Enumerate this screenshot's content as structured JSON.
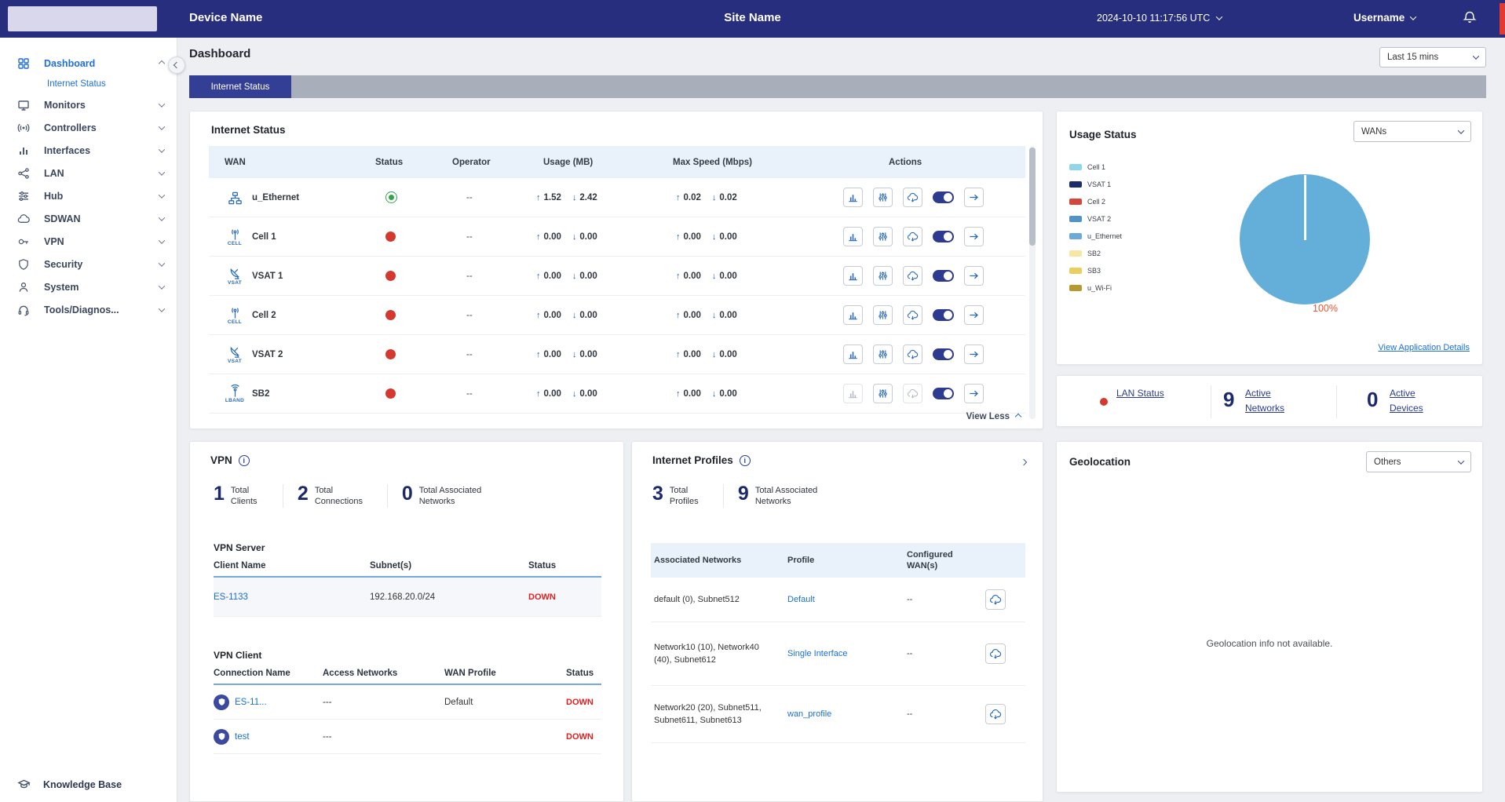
{
  "colors": {
    "topbar_bg": "#272e7d",
    "accent_blue": "#1b6fd8",
    "navy": "#1c296b",
    "status_up_green": "#35a34b",
    "status_down_red": "#d5382e",
    "down_text_red": "#e01f1f",
    "pie_label_orange": "#e4572e"
  },
  "topbar": {
    "device_name": "Device Name",
    "site_name": "Site Name",
    "datetime": "2024-10-10 11:17:56 UTC",
    "username": "Username"
  },
  "sidebar": {
    "items": [
      {
        "label": "Dashboard"
      },
      {
        "label": "Internet Status"
      },
      {
        "label": "Monitors"
      },
      {
        "label": "Controllers"
      },
      {
        "label": "Interfaces"
      },
      {
        "label": "LAN"
      },
      {
        "label": "Hub"
      },
      {
        "label": "SDWAN"
      },
      {
        "label": "VPN"
      },
      {
        "label": "Security"
      },
      {
        "label": "System"
      },
      {
        "label": "Tools/Diagnos..."
      }
    ],
    "knowledge_base": "Knowledge Base"
  },
  "page": {
    "title": "Dashboard",
    "time_filter": "Last 15 mins",
    "active_tab": "Internet Status"
  },
  "internet_status": {
    "title": "Internet Status",
    "columns": {
      "wan": "WAN",
      "status": "Status",
      "operator": "Operator",
      "usage": "Usage (MB)",
      "max_speed": "Max Speed (Mbps)",
      "actions": "Actions"
    },
    "rows": [
      {
        "wan": "u_Ethernet",
        "caption": "",
        "status": "Up",
        "operator": "--",
        "usage_up": "1.52",
        "usage_down": "2.42",
        "speed_up": "0.02",
        "speed_down": "0.02"
      },
      {
        "wan": "Cell 1",
        "caption": "CELL",
        "status": "Down",
        "operator": "--",
        "usage_up": "0.00",
        "usage_down": "0.00",
        "speed_up": "0.00",
        "speed_down": "0.00"
      },
      {
        "wan": "VSAT 1",
        "caption": "VSAT",
        "status": "Down",
        "operator": "--",
        "usage_up": "0.00",
        "usage_down": "0.00",
        "speed_up": "0.00",
        "speed_down": "0.00"
      },
      {
        "wan": "Cell 2",
        "caption": "CELL",
        "status": "Down",
        "operator": "--",
        "usage_up": "0.00",
        "usage_down": "0.00",
        "speed_up": "0.00",
        "speed_down": "0.00"
      },
      {
        "wan": "VSAT 2",
        "caption": "VSAT",
        "status": "Down",
        "operator": "--",
        "usage_up": "0.00",
        "usage_down": "0.00",
        "speed_up": "0.00",
        "speed_down": "0.00"
      },
      {
        "wan": "SB2",
        "caption": "LBAND",
        "status": "Down",
        "operator": "--",
        "usage_up": "0.00",
        "usage_down": "0.00",
        "speed_up": "0.00",
        "speed_down": "0.00"
      }
    ],
    "view_less": "View Less"
  },
  "usage_status": {
    "title": "Usage Status",
    "filter": "WANs",
    "legend": [
      {
        "label": "Cell 1",
        "color": "#8ed7e9"
      },
      {
        "label": "VSAT 1",
        "color": "#1b2e6b"
      },
      {
        "label": "Cell 2",
        "color": "#d6473b"
      },
      {
        "label": "VSAT 2",
        "color": "#4f93c9"
      },
      {
        "label": "u_Ethernet",
        "color": "#6cabd9"
      },
      {
        "label": "SB2",
        "color": "#f6e8a4"
      },
      {
        "label": "SB3",
        "color": "#e9cf5f"
      },
      {
        "label": "u_Wi-Fi",
        "color": "#b9992f"
      }
    ],
    "pie_color": "#64afda",
    "pie_label": "100%",
    "details_link": "View Application Details"
  },
  "chart_data": {
    "type": "pie",
    "title": "Usage Status",
    "labels": [
      "u_Ethernet"
    ],
    "values": [
      100
    ],
    "unit": "%",
    "legend_entries": [
      "Cell 1",
      "VSAT 1",
      "Cell 2",
      "VSAT 2",
      "u_Ethernet",
      "SB2",
      "SB3",
      "u_Wi-Fi"
    ],
    "annotation": "100%",
    "legend_position": "left"
  },
  "lan_summary": {
    "lan_status_label": "LAN Status",
    "active_networks_value": "9",
    "active_networks_label": "Active Networks",
    "active_devices_value": "0",
    "active_devices_label": "Active Devices"
  },
  "vpn": {
    "title": "VPN",
    "stats": [
      {
        "value": "1",
        "label": "Total Clients"
      },
      {
        "value": "2",
        "label": "Total Connections"
      },
      {
        "value": "0",
        "label": "Total Associated Networks"
      }
    ],
    "server": {
      "heading": "VPN Server",
      "columns": {
        "client": "Client Name",
        "subnets": "Subnet(s)",
        "status": "Status"
      },
      "rows": [
        {
          "client": "ES-1133",
          "subnets": "192.168.20.0/24",
          "status": "DOWN"
        }
      ]
    },
    "client": {
      "heading": "VPN Client",
      "columns": {
        "name": "Connection Name",
        "access": "Access Networks",
        "profile": "WAN Profile",
        "status": "Status"
      },
      "rows": [
        {
          "name": "ES-11...",
          "access": "---",
          "profile": "Default",
          "status": "DOWN"
        },
        {
          "name": "test",
          "access": "---",
          "profile": "",
          "status": "DOWN"
        }
      ]
    }
  },
  "internet_profiles": {
    "title": "Internet Profiles",
    "stats": [
      {
        "value": "3",
        "label": "Total Profiles"
      },
      {
        "value": "9",
        "label": "Total Associated Networks"
      }
    ],
    "columns": {
      "networks": "Associated Networks",
      "profile": "Profile",
      "wans": "Configured WAN(s)"
    },
    "rows": [
      {
        "networks": "default (0), Subnet512",
        "profile": "Default",
        "wans": "--"
      },
      {
        "networks": "Network10 (10), Network40 (40), Subnet612",
        "profile": "Single Interface",
        "wans": "--"
      },
      {
        "networks": "Network20 (20), Subnet511, Subnet611, Subnet613",
        "profile": "wan_profile",
        "wans": "--"
      }
    ]
  },
  "geolocation": {
    "title": "Geolocation",
    "filter": "Others",
    "message": "Geolocation info not available."
  }
}
